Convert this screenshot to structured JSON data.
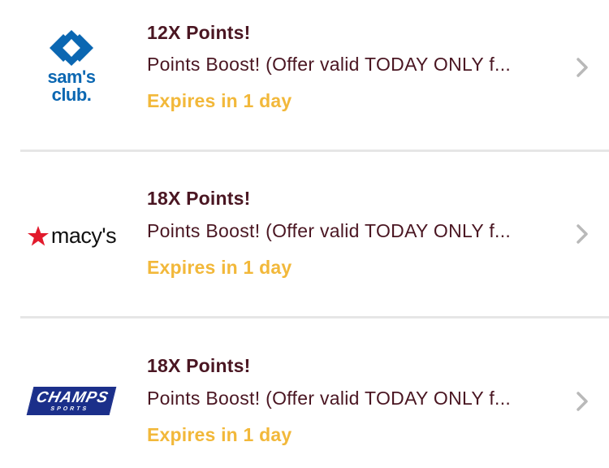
{
  "offers": [
    {
      "merchant_logo_text": [
        "sam's",
        "club."
      ],
      "title": "12X Points!",
      "description": "Points Boost! (Offer valid TODAY ONLY f...",
      "expires": "Expires in 1 day"
    },
    {
      "merchant_logo_text": [
        "macy's"
      ],
      "title": "18X Points!",
      "description": "Points Boost! (Offer valid TODAY ONLY f...",
      "expires": "Expires in 1 day"
    },
    {
      "merchant_logo_text": [
        "CHAMPS",
        "SPORTS"
      ],
      "title": "18X Points!",
      "description": "Points Boost! (Offer valid TODAY ONLY f...",
      "expires": "Expires in 1 day"
    }
  ],
  "icons": {
    "chevron": "chevron-right-icon",
    "sams_diamond": "sams-club-diamond-icon",
    "macys_star": "macys-star-icon"
  },
  "colors": {
    "title": "#4a1622",
    "expires": "#f2b83a",
    "sams_blue": "#0b67b2",
    "macys_red": "#e21a2c",
    "champs_blue": "#1b2f8a",
    "divider": "#e6e6e6",
    "chevron": "#b9b9b9"
  }
}
